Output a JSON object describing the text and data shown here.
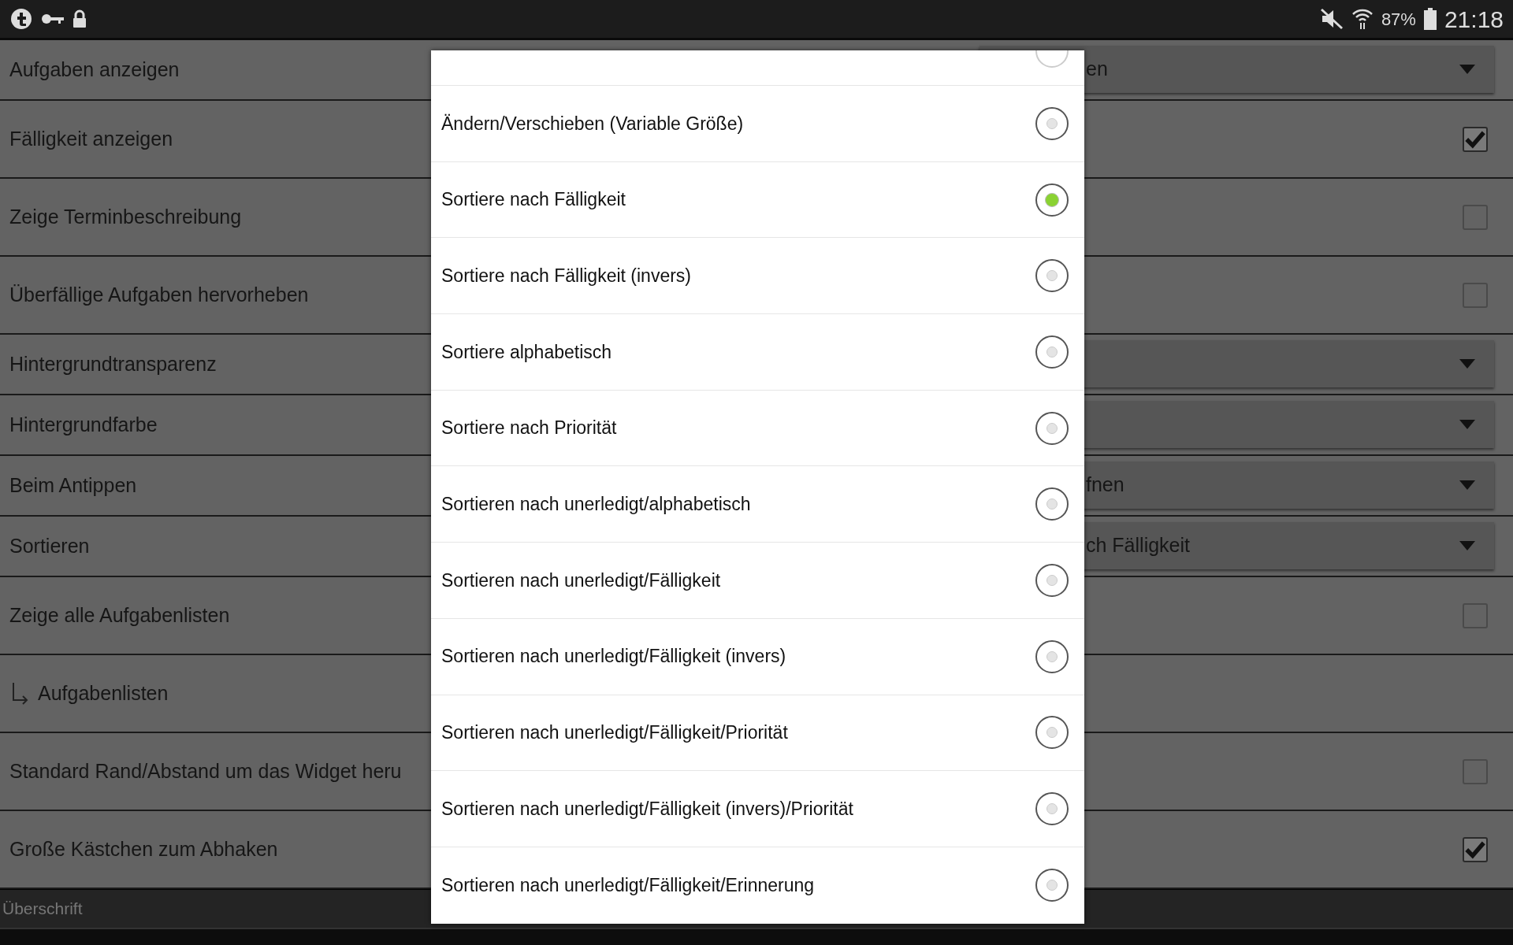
{
  "status_bar": {
    "battery": "87%",
    "time": "21:18"
  },
  "settings": [
    {
      "kind": "dropdown",
      "label": "Aufgaben anzeigen",
      "value": "en"
    },
    {
      "kind": "checkbox",
      "label": "Fälligkeit anzeigen",
      "checked": true
    },
    {
      "kind": "checkbox",
      "label": "Zeige Terminbeschreibung",
      "checked": false
    },
    {
      "kind": "checkbox",
      "label": "Überfällige Aufgaben hervorheben",
      "checked": false
    },
    {
      "kind": "dropdown",
      "label": "Hintergrundtransparenz"
    },
    {
      "kind": "dropdown",
      "label": "Hintergrundfarbe"
    },
    {
      "kind": "dropdown",
      "label": "Beim Antippen",
      "value": "fnen"
    },
    {
      "kind": "dropdown",
      "label": "Sortieren",
      "value": "ch Fälligkeit"
    },
    {
      "kind": "checkbox",
      "label": "Zeige alle Aufgabenlisten",
      "checked": false
    },
    {
      "kind": "sub",
      "label": "Aufgabenlisten"
    },
    {
      "kind": "checkbox",
      "label": "Standard Rand/Abstand um das Widget heru",
      "checked": false
    },
    {
      "kind": "checkbox",
      "label": "Große Kästchen zum Abhaken",
      "checked": true
    }
  ],
  "section_header": "Überschrift",
  "dialog": {
    "cut_off_option": {
      "selected": false
    },
    "options": [
      {
        "label": "Ändern/Verschieben (Variable Größe)",
        "selected": false
      },
      {
        "label": "Sortiere nach Fälligkeit",
        "selected": true
      },
      {
        "label": "Sortiere nach Fälligkeit (invers)",
        "selected": false
      },
      {
        "label": "Sortiere alphabetisch",
        "selected": false
      },
      {
        "label": "Sortiere nach Priorität",
        "selected": false
      },
      {
        "label": "Sortieren nach unerledigt/alphabetisch",
        "selected": false
      },
      {
        "label": "Sortieren nach unerledigt/Fälligkeit",
        "selected": false
      },
      {
        "label": "Sortieren nach unerledigt/Fälligkeit (invers)",
        "selected": false
      },
      {
        "label": "Sortieren nach unerledigt/Fälligkeit/Priorität",
        "selected": false
      },
      {
        "label": "Sortieren nach unerledigt/Fälligkeit (invers)/Priorität",
        "selected": false
      },
      {
        "label": "Sortieren nach unerledigt/Fälligkeit/Erinnerung",
        "selected": false
      }
    ]
  }
}
